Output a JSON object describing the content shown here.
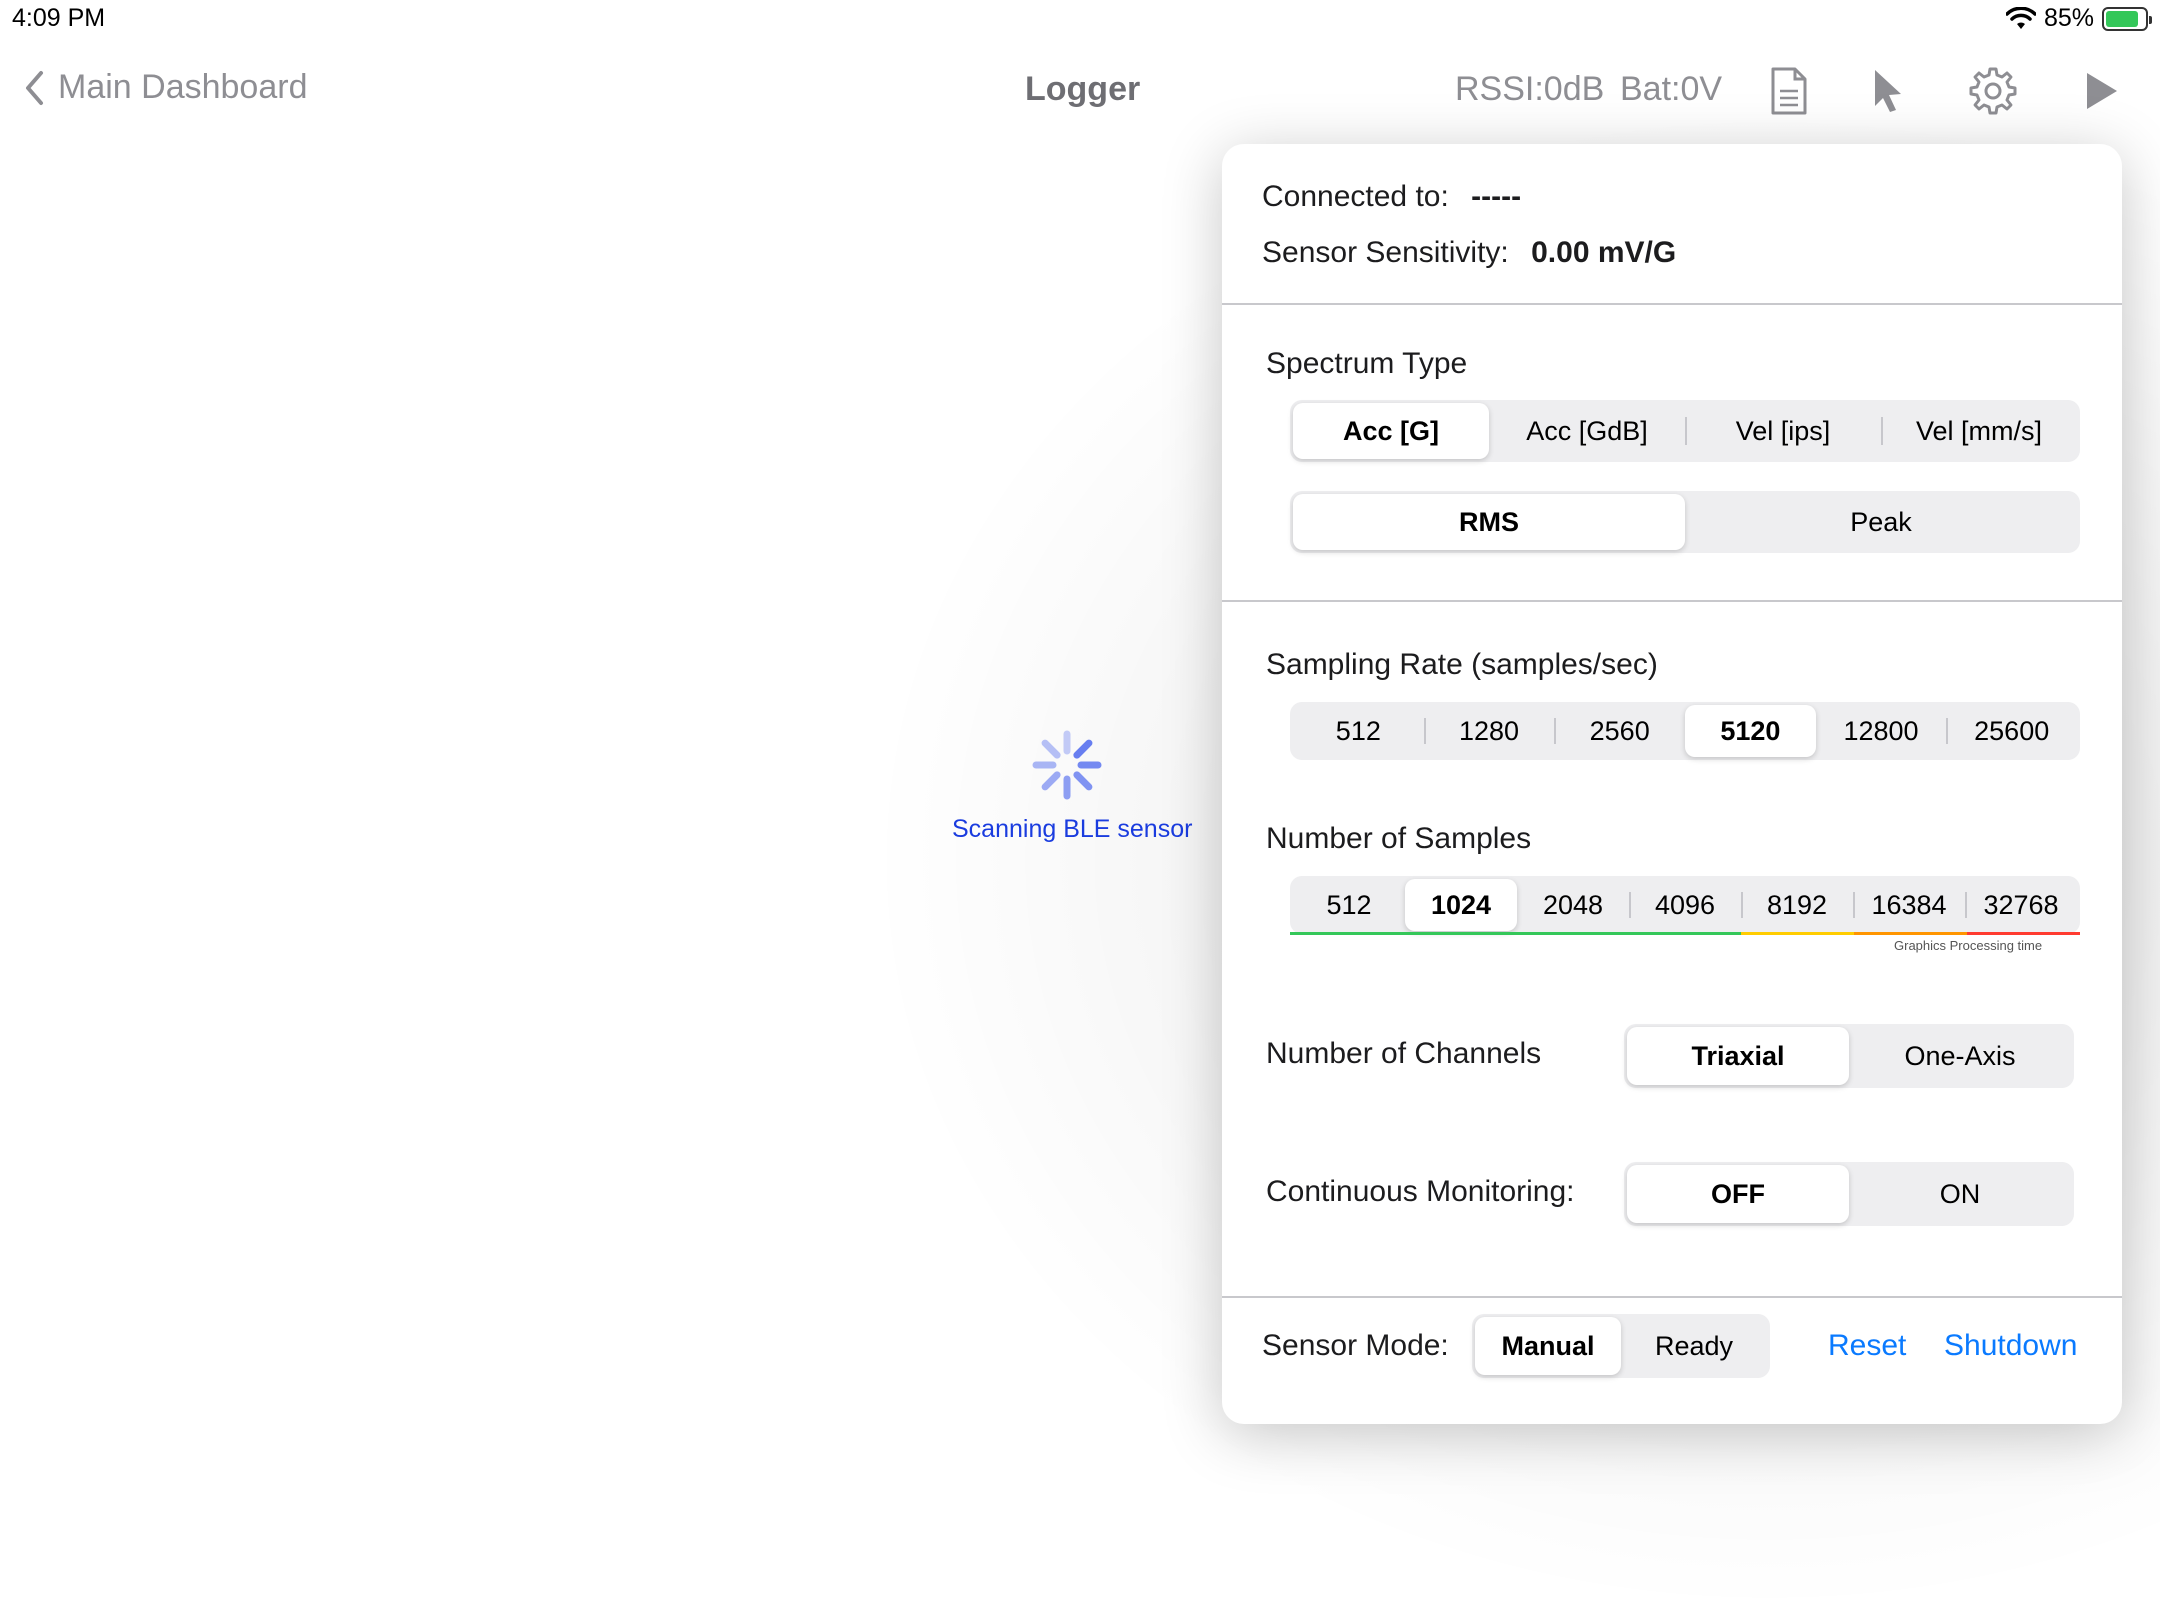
{
  "status": {
    "time": "4:09 PM",
    "battery_pct": "85%",
    "battery_level": 0.85
  },
  "nav": {
    "back_label": "Main Dashboard",
    "title": "Logger",
    "rssi": "RSSI:0dB",
    "bat": "Bat:0V",
    "icons": [
      "document-icon",
      "pointer-icon",
      "gear-icon",
      "play-icon"
    ]
  },
  "scan": {
    "label": "Scanning BLE sensor"
  },
  "popover": {
    "connected_label": "Connected to:",
    "connected_value": "-----",
    "sensitivity_label": "Sensor Sensitivity:",
    "sensitivity_value": "0.00 mV/G",
    "spectrum": {
      "label": "Spectrum Type",
      "types": [
        "Acc [G]",
        "Acc [GdB]",
        "Vel [ips]",
        "Vel [mm/s]"
      ],
      "types_selected": 0,
      "modes": [
        "RMS",
        "Peak"
      ],
      "modes_selected": 0
    },
    "sampling": {
      "label": "Sampling Rate (samples/sec)",
      "options": [
        "512",
        "1280",
        "2560",
        "5120",
        "12800",
        "25600"
      ],
      "selected": 3
    },
    "samples": {
      "label": "Number of Samples",
      "options": [
        "512",
        "1024",
        "2048",
        "4096",
        "8192",
        "16384",
        "32768"
      ],
      "selected": 1,
      "note": "Graphics Processing time",
      "colors": {
        "green": "#34c759",
        "yellow": "#ffcc00",
        "orange": "#ff9500",
        "red": "#ff3b30"
      }
    },
    "channels": {
      "label": "Number of Channels",
      "options": [
        "Triaxial",
        "One-Axis"
      ],
      "selected": 0
    },
    "monitoring": {
      "label": "Continuous Monitoring:",
      "options": [
        "OFF",
        "ON"
      ],
      "selected": 0
    },
    "mode": {
      "label": "Sensor Mode:",
      "options": [
        "Manual",
        "Ready"
      ],
      "selected": 0
    },
    "reset_label": "Reset",
    "shutdown_label": "Shutdown"
  },
  "colors": {
    "accent": "#0a7aff",
    "scan_text": "#1a3cdf",
    "spinner": "#5b74f0"
  }
}
